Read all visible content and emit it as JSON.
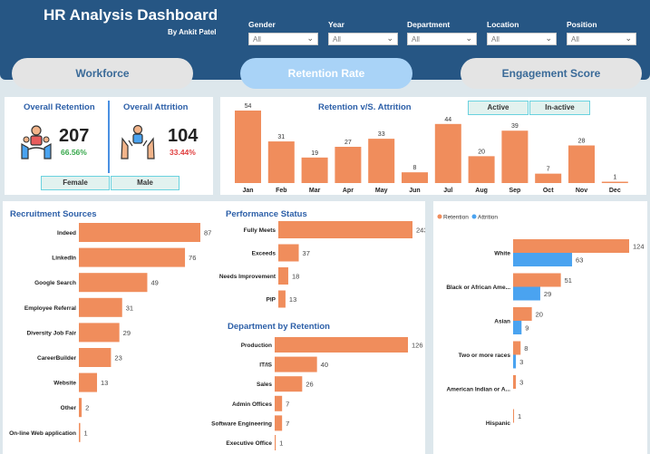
{
  "header": {
    "title": "HR Analysis Dashboard",
    "author": "By Ankit Patel",
    "filters": [
      {
        "label": "Gender",
        "value": "All"
      },
      {
        "label": "Year",
        "value": "All"
      },
      {
        "label": "Department",
        "value": "All"
      },
      {
        "label": "Location",
        "value": "All"
      },
      {
        "label": "Position",
        "value": "All"
      }
    ]
  },
  "tabs": [
    {
      "label": "Workforce",
      "active": false
    },
    {
      "label": "Retention Rate",
      "active": true
    },
    {
      "label": "Engagement Score",
      "active": false
    }
  ],
  "kpis": {
    "retention_title": "Overall Retention",
    "retention_value": "207",
    "retention_pct": "66.56%",
    "attrition_title": "Overall Attrition",
    "attrition_value": "104",
    "attrition_pct": "33.44%",
    "female_button": "Female",
    "male_button": "Male"
  },
  "colors": {
    "bar": "#f08d5c",
    "attrition": "#4aa3f0",
    "title": "#2c5fa8",
    "header": "#265684",
    "green": "#38a84c",
    "red": "#e04040"
  },
  "icons": [
    "retention-people-icon",
    "attrition-people-icon",
    "chevron-down-icon"
  ],
  "chart_data": [
    {
      "type": "bar",
      "title": "Retention v/S. Attrition",
      "buttons": [
        "Active",
        "In-active"
      ],
      "categories": [
        "Jan",
        "Feb",
        "Mar",
        "Apr",
        "May",
        "Jun",
        "Jul",
        "Aug",
        "Sep",
        "Oct",
        "Nov",
        "Dec"
      ],
      "values": [
        54,
        31,
        19,
        27,
        33,
        8,
        44,
        20,
        39,
        7,
        28,
        1
      ]
    },
    {
      "type": "bar",
      "orientation": "horizontal",
      "title": "Recruitment Sources",
      "categories": [
        "Indeed",
        "LinkedIn",
        "Google Search",
        "Employee Referral",
        "Diversity Job Fair",
        "CareerBuilder",
        "Website",
        "Other",
        "On-line Web application"
      ],
      "values": [
        87,
        76,
        49,
        31,
        29,
        23,
        13,
        2,
        1
      ]
    },
    {
      "type": "bar",
      "orientation": "horizontal",
      "title": "Performance Status",
      "categories": [
        "Fully Meets",
        "Exceeds",
        "Needs Improvement",
        "PIP"
      ],
      "values": [
        243,
        37,
        18,
        13
      ]
    },
    {
      "type": "bar",
      "orientation": "horizontal",
      "title": "Department by Retention",
      "categories": [
        "Production",
        "IT/IS",
        "Sales",
        "Admin Offices",
        "Software Engineering",
        "Executive Office"
      ],
      "values": [
        126,
        40,
        26,
        7,
        7,
        1
      ]
    },
    {
      "type": "bar",
      "orientation": "horizontal",
      "legend": "top-left",
      "categories": [
        "White",
        "Black or African Ame...",
        "Asian",
        "Two or more races",
        "American Indian or A...",
        "Hispanic"
      ],
      "series": [
        {
          "name": "Retention",
          "values": [
            124,
            51,
            20,
            8,
            3,
            1
          ]
        },
        {
          "name": "Attrition",
          "values": [
            63,
            29,
            9,
            3,
            null,
            null
          ]
        }
      ]
    }
  ]
}
